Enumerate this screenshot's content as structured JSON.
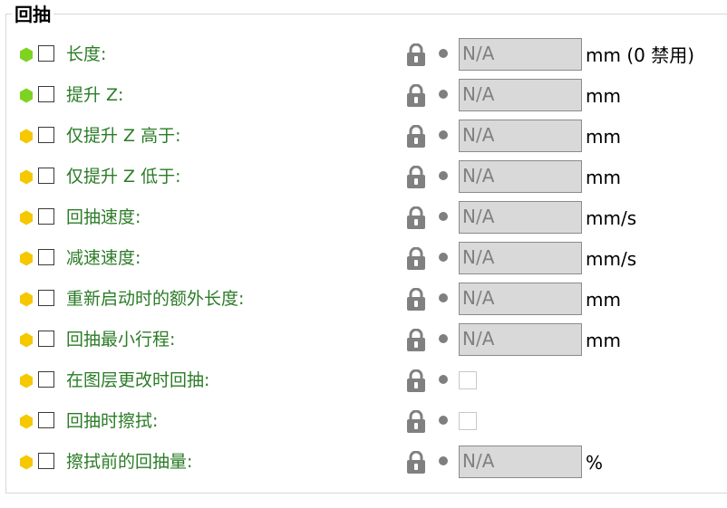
{
  "group": {
    "title": "回抽",
    "rows": [
      {
        "label": "长度:",
        "level": "simple",
        "value": "N/A",
        "unit": "mm (0 禁用)",
        "control": "field"
      },
      {
        "label": "提升 Z:",
        "level": "simple",
        "value": "N/A",
        "unit": "mm",
        "control": "field"
      },
      {
        "label": "仅提升 Z 高于:",
        "level": "advanced",
        "value": "N/A",
        "unit": "mm",
        "control": "field"
      },
      {
        "label": "仅提升 Z 低于:",
        "level": "advanced",
        "value": "N/A",
        "unit": "mm",
        "control": "field"
      },
      {
        "label": "回抽速度:",
        "level": "advanced",
        "value": "N/A",
        "unit": "mm/s",
        "control": "field"
      },
      {
        "label": "减速速度:",
        "level": "advanced",
        "value": "N/A",
        "unit": "mm/s",
        "control": "field"
      },
      {
        "label": "重新启动时的额外长度:",
        "level": "advanced",
        "value": "N/A",
        "unit": "mm",
        "control": "field"
      },
      {
        "label": "回抽最小行程:",
        "level": "advanced",
        "value": "N/A",
        "unit": "mm",
        "control": "field"
      },
      {
        "label": "在图层更改时回抽:",
        "level": "advanced",
        "control": "checkbox"
      },
      {
        "label": "回抽时擦拭:",
        "level": "advanced",
        "control": "checkbox"
      },
      {
        "label": "擦拭前的回抽量:",
        "level": "advanced",
        "value": "N/A",
        "unit": "%",
        "control": "field"
      }
    ]
  },
  "colors": {
    "simple": "#7ed321",
    "advanced": "#f5c800",
    "label": "#2b7c27",
    "lock": "#808080"
  },
  "icons": {
    "level": "hexagon-icon",
    "lock": "lock-icon",
    "reset": "dot-icon"
  }
}
